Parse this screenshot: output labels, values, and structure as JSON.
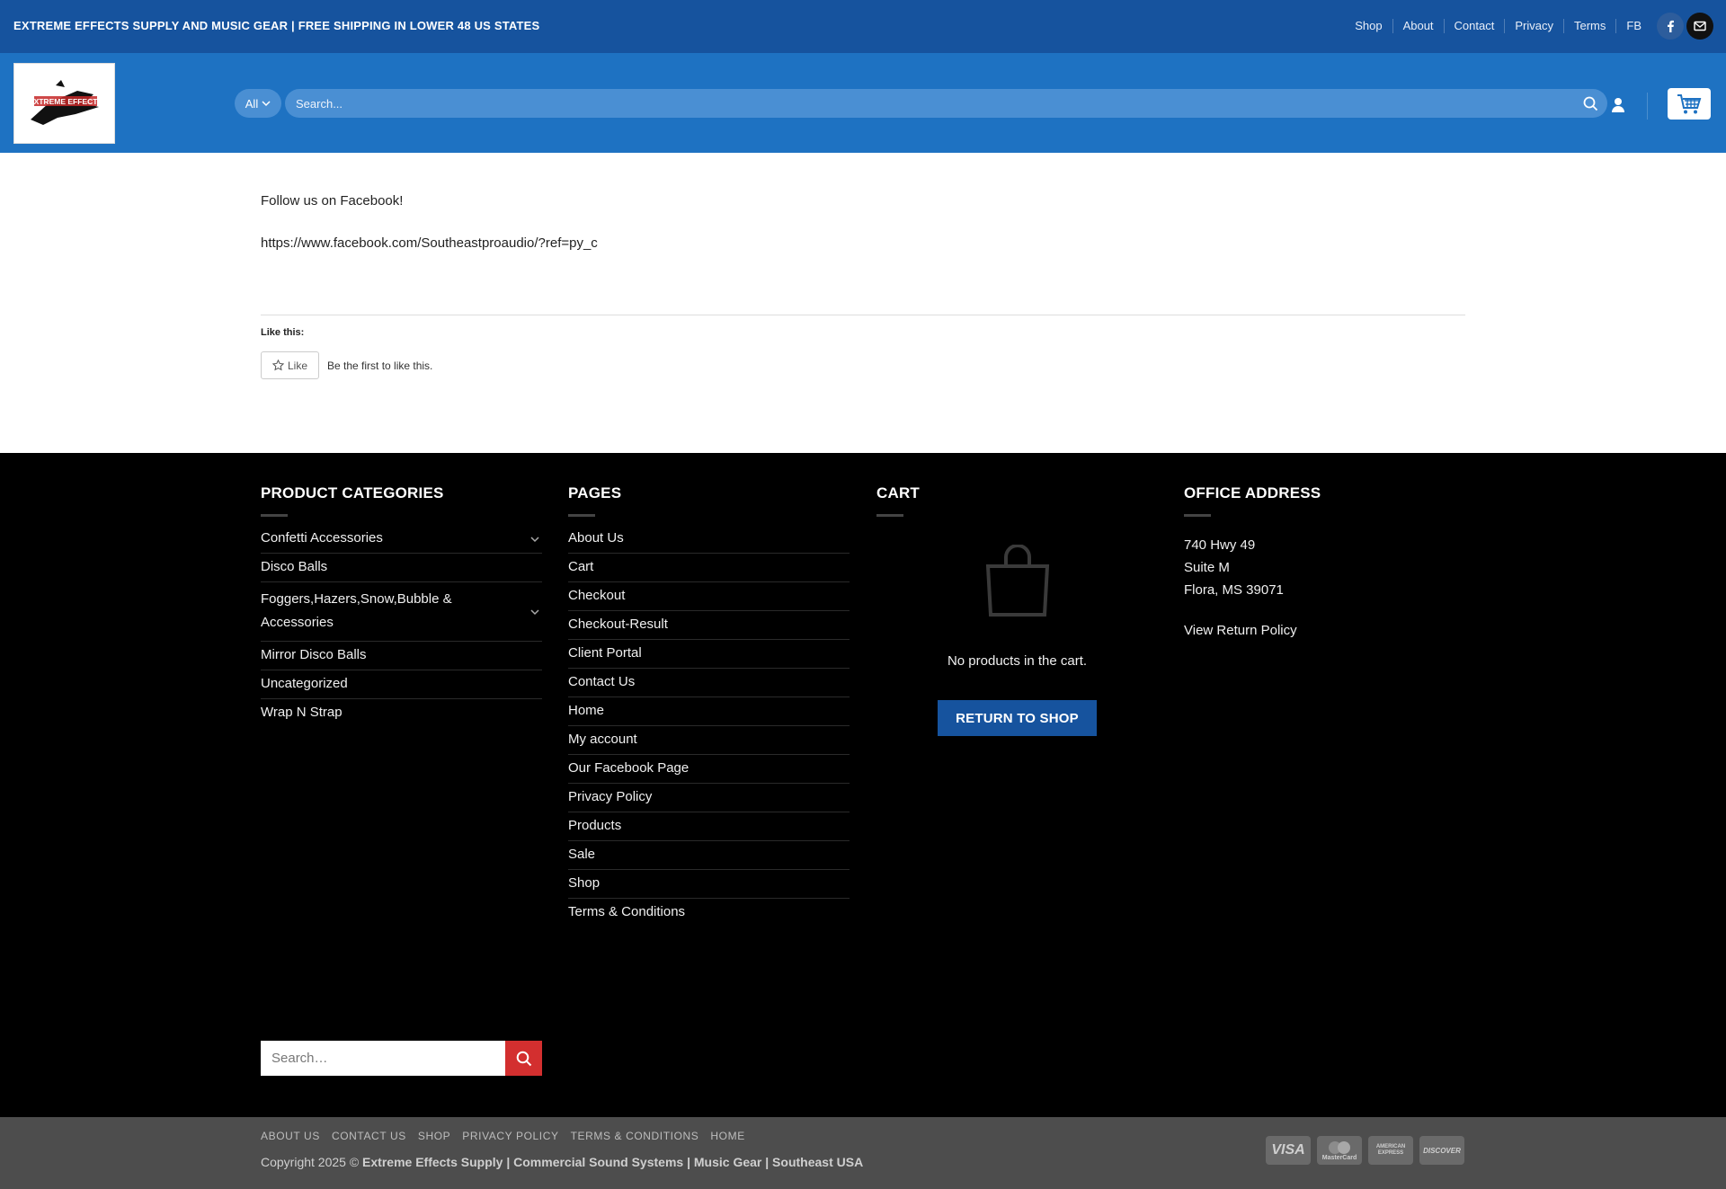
{
  "topbar": {
    "promo": "EXTREME EFFECTS SUPPLY AND MUSIC GEAR | FREE SHIPPING IN LOWER 48 US STATES",
    "nav": [
      "Shop",
      "About",
      "Contact",
      "Privacy",
      "Terms",
      "FB"
    ],
    "bg_color": "#16539e"
  },
  "header": {
    "logo_text": "EXTREME EFFECTS",
    "category_select": "All",
    "search_placeholder": "Search...",
    "bg_color": "#1e72c2"
  },
  "main": {
    "paragraph_1": "Follow us on Facebook!",
    "paragraph_2": "https://www.facebook.com/Southeastproaudio/?ref=py_c",
    "like_heading": "Like this:",
    "like_button": "Like",
    "like_first": "Be the first to like this."
  },
  "footer": {
    "categories": {
      "title": "PRODUCT CATEGORIES",
      "items": [
        "Confetti Accessories",
        "Disco Balls",
        "Foggers,Hazers,Snow,Bubble & Accessories",
        "Mirror Disco Balls",
        "Uncategorized",
        "Wrap N Strap"
      ]
    },
    "pages": {
      "title": "PAGES",
      "items": [
        "About Us",
        "Cart",
        "Checkout",
        "Checkout-Result",
        "Client Portal",
        "Contact Us",
        "Home",
        "My account",
        "Our Facebook Page",
        "Privacy Policy",
        "Products",
        "Sale",
        "Shop",
        "Terms & Conditions"
      ]
    },
    "cart": {
      "title": "CART",
      "empty_text": "No products in the cart.",
      "return_button": "RETURN TO SHOP"
    },
    "office": {
      "title": "OFFICE ADDRESS",
      "line1": "740 Hwy 49",
      "line2": "Suite M",
      "line3": "Flora, MS 39071",
      "return_policy": "View Return Policy"
    },
    "search_placeholder": "Search…"
  },
  "absolute_footer": {
    "nav": [
      "ABOUT US",
      "CONTACT US",
      "SHOP",
      "PRIVACY POLICY",
      "TERMS & CONDITIONS",
      "HOME"
    ],
    "copyright_prefix": "Copyright 2025 ©",
    "copyright_name": "Extreme Effects Supply | Commercial Sound Systems | Music Gear | Southeast USA",
    "payments": [
      "VISA",
      "MasterCard",
      "AMERICAN EXPRESS",
      "DISCOVER"
    ]
  }
}
